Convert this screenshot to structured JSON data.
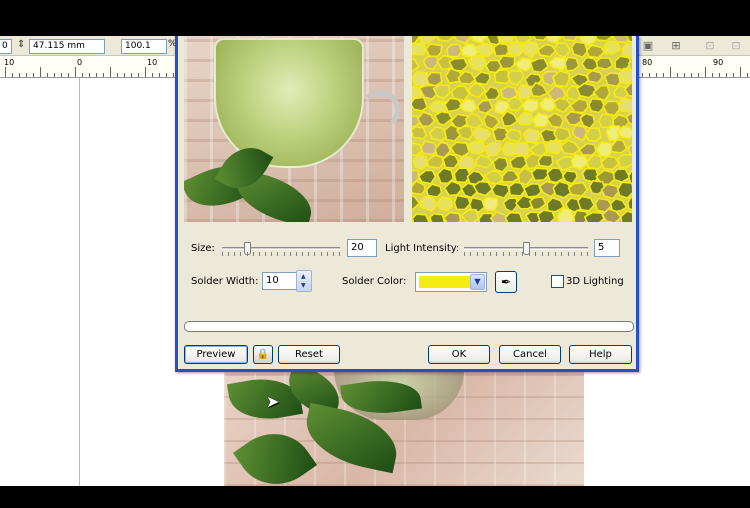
{
  "property_bar": {
    "left_value": "0",
    "height_value": "47.115 mm",
    "scale_value": "100.1",
    "scale_unit": "%"
  },
  "ruler": {
    "labels": [
      {
        "text": "10"
      },
      {
        "text": "0"
      },
      {
        "text": "10"
      },
      {
        "text": "80"
      },
      {
        "text": "90"
      }
    ]
  },
  "dialog": {
    "size_label": "Size:",
    "size_value": "20",
    "size_slider_level": 0.2,
    "light_intensity_label": "Light Intensity:",
    "light_intensity_value": "5",
    "light_intensity_slider_level": 0.5,
    "solder_width_label": "Solder Width:",
    "solder_width_value": "10",
    "solder_color_label": "Solder Color:",
    "solder_color": "#f4ec10",
    "lighting_3d_label": "3D Lighting",
    "lighting_3d_checked": false,
    "progress": 0,
    "buttons": {
      "preview": "Preview",
      "reset": "Reset",
      "ok": "OK",
      "cancel": "Cancel",
      "help": "Help"
    }
  },
  "icons": {
    "height": "height-arrows-icon",
    "lock": "lock-icon",
    "eyedropper": "eyedropper-icon",
    "cursor": "mouse-pointer-icon",
    "spin": "spin-up-down-icon",
    "dropdown": "chevron-down-icon"
  },
  "colors": {
    "dialog_bg": "#ece9d8",
    "title_border": "#2150c8",
    "solder": "#f4ec10"
  }
}
